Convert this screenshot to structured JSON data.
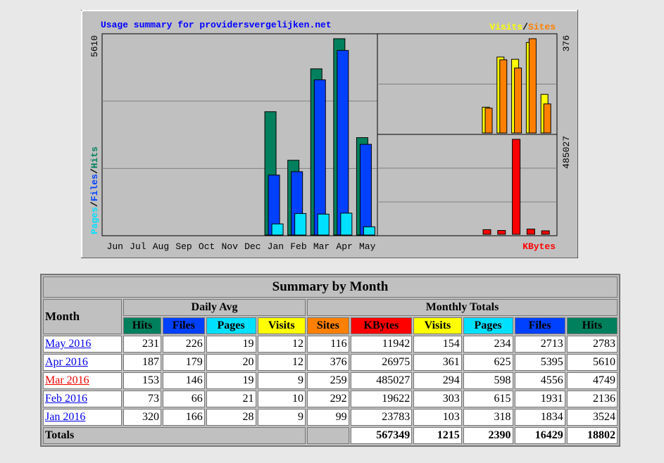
{
  "chart_data": {
    "type": "bar",
    "title": "Usage summary for providersvergelijken.net",
    "categories": [
      "Jun",
      "Jul",
      "Aug",
      "Sep",
      "Oct",
      "Nov",
      "Dec",
      "Jan",
      "Feb",
      "Mar",
      "Apr",
      "May"
    ],
    "panels": [
      {
        "name": "hits-files-pages",
        "legend": [
          "Pages",
          "Files",
          "Hits"
        ],
        "max_label": "5610",
        "ylim": [
          0,
          5610
        ],
        "series": [
          {
            "name": "Hits",
            "color": "#00805c",
            "values": [
              0,
              0,
              0,
              0,
              0,
              0,
              0,
              3524,
              2136,
              4749,
              5610,
              2783
            ]
          },
          {
            "name": "Files",
            "color": "#0040ff",
            "values": [
              0,
              0,
              0,
              0,
              0,
              0,
              0,
              1834,
              1931,
              4556,
              5395,
              2713
            ]
          },
          {
            "name": "Pages",
            "color": "#00e0ff",
            "values": [
              0,
              0,
              0,
              0,
              0,
              0,
              0,
              318,
              615,
              598,
              625,
              234
            ]
          }
        ]
      },
      {
        "name": "visits-sites",
        "legend": [
          "Visits",
          "Sites"
        ],
        "max_label": "376",
        "ylim": [
          0,
          376
        ],
        "series": [
          {
            "name": "Visits",
            "color": "#ffff00",
            "values": [
              103,
              303,
              294,
              361,
              154
            ]
          },
          {
            "name": "Sites",
            "color": "#ff8000",
            "values": [
              99,
              292,
              259,
              376,
              116
            ]
          }
        ]
      },
      {
        "name": "kbytes",
        "legend": [
          "KBytes"
        ],
        "max_label": "485027",
        "ylim": [
          0,
          485027
        ],
        "series": [
          {
            "name": "KBytes",
            "color": "#ff0000",
            "values": [
              23783,
              19622,
              485027,
              26975,
              11942
            ]
          }
        ]
      }
    ]
  },
  "table": {
    "title": "Summary by Month",
    "month_header": "Month",
    "daily_avg_header": "Daily Avg",
    "monthly_totals_header": "Monthly Totals",
    "columns": [
      {
        "label": "Hits",
        "color": "#00805c"
      },
      {
        "label": "Files",
        "color": "#0040ff"
      },
      {
        "label": "Pages",
        "color": "#00e0ff"
      },
      {
        "label": "Visits",
        "color": "#ffff00"
      },
      {
        "label": "Sites",
        "color": "#ff8000"
      },
      {
        "label": "KBytes",
        "color": "#ff0000"
      },
      {
        "label": "Visits",
        "color": "#ffff00"
      },
      {
        "label": "Pages",
        "color": "#00e0ff"
      },
      {
        "label": "Files",
        "color": "#0040ff"
      },
      {
        "label": "Hits",
        "color": "#00805c"
      }
    ],
    "rows": [
      {
        "month": "May 2016",
        "current": false,
        "values": [
          "231",
          "226",
          "19",
          "12",
          "116",
          "11942",
          "154",
          "234",
          "2713",
          "2783"
        ]
      },
      {
        "month": "Apr 2016",
        "current": false,
        "values": [
          "187",
          "179",
          "20",
          "12",
          "376",
          "26975",
          "361",
          "625",
          "5395",
          "5610"
        ]
      },
      {
        "month": "Mar 2016",
        "current": true,
        "values": [
          "153",
          "146",
          "19",
          "9",
          "259",
          "485027",
          "294",
          "598",
          "4556",
          "4749"
        ]
      },
      {
        "month": "Feb 2016",
        "current": false,
        "values": [
          "73",
          "66",
          "21",
          "10",
          "292",
          "19622",
          "303",
          "615",
          "1931",
          "2136"
        ]
      },
      {
        "month": "Jan 2016",
        "current": false,
        "values": [
          "320",
          "166",
          "28",
          "9",
          "99",
          "23783",
          "103",
          "318",
          "1834",
          "3524"
        ]
      }
    ],
    "totals_label": "Totals",
    "totals": [
      "567349",
      "1215",
      "2390",
      "16429",
      "18802"
    ]
  }
}
